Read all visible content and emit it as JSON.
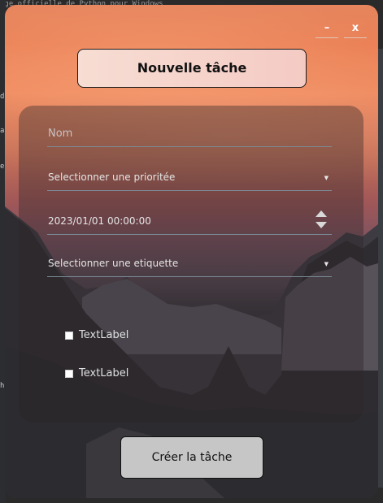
{
  "background": {
    "partial_text": "age officielle de Python pour Windows"
  },
  "window": {
    "controls": {
      "minimize_label": "–",
      "close_label": "x"
    },
    "title": "Nouvelle tâche",
    "form": {
      "name_placeholder": "Nom",
      "priority_select": "Selectionner une prioritée",
      "datetime_value": "2023/01/01 00:00:00",
      "label_select": "Selectionner une etiquette",
      "checkbox_1_label": "TextLabel",
      "checkbox_2_label": "TextLabel"
    },
    "create_button_label": "Créer la tâche"
  },
  "colors": {
    "panel": "rgba(42,38,40,0.38)",
    "title_box": "#f4cbc4",
    "button": "#c6c6c6",
    "underline": "#7b8b96"
  }
}
